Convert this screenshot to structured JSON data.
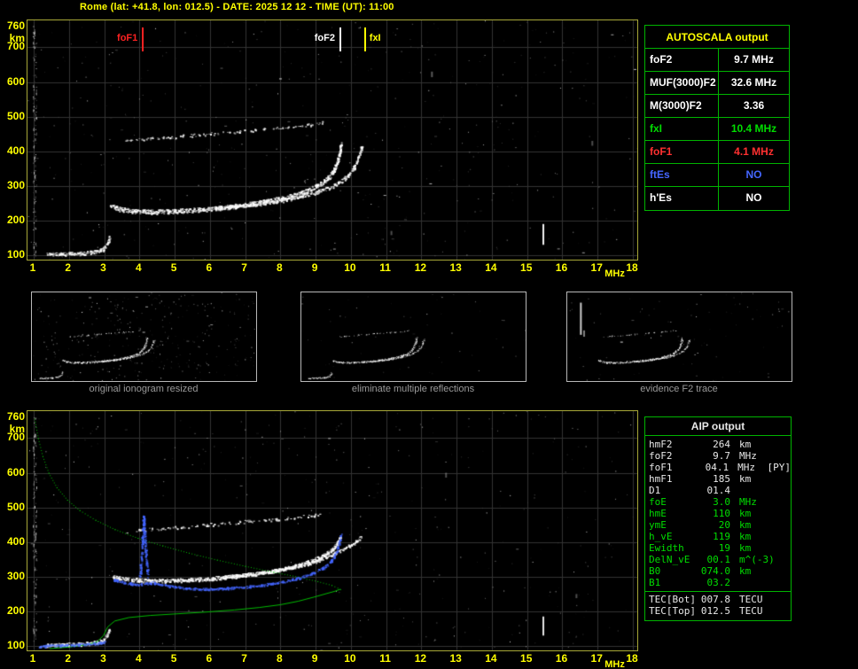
{
  "header": {
    "title": "Rome (lat: +41.8, lon: 012.5) - DATE: 2025 12 12 - TIME (UT): 11:00"
  },
  "colors": {
    "background": "#000000",
    "axis_text": "#ffff00",
    "plot_border": "#a8a838",
    "grid": "#333333",
    "table_border": "#00b400",
    "white": "#e8e8e8",
    "green": "#00dd00",
    "red": "#ff3030",
    "blue": "#4466ff",
    "caption": "#999999"
  },
  "axes": {
    "x_unit": "MHz",
    "y_unit": "km",
    "x_ticks": [
      1,
      2,
      3,
      4,
      5,
      6,
      7,
      8,
      9,
      10,
      11,
      12,
      13,
      14,
      15,
      16,
      17,
      18
    ],
    "y_ticks": [
      760,
      700,
      600,
      500,
      400,
      300,
      200,
      100
    ]
  },
  "autoscala": {
    "title": "AUTOSCALA output",
    "rows": [
      {
        "label": "foF2",
        "value": "9.7 MHz",
        "color": "#ffffff"
      },
      {
        "label": "MUF(3000)F2",
        "value": "32.6 MHz",
        "color": "#ffffff"
      },
      {
        "label": "M(3000)F2",
        "value": "3.36",
        "color": "#ffffff"
      },
      {
        "label": "fxI",
        "value": "10.4 MHz",
        "color": "#00dd00"
      },
      {
        "label": "foF1",
        "value": "4.1 MHz",
        "color": "#ff3030"
      },
      {
        "label": "ftEs",
        "value": "NO",
        "color": "#4466ff"
      },
      {
        "label": "h'Es",
        "value": "NO",
        "color": "#ffffff"
      }
    ]
  },
  "thumbnails": [
    {
      "caption": "original ionogram resized"
    },
    {
      "caption": "eliminate multiple reflections"
    },
    {
      "caption": "evidence F2 trace"
    }
  ],
  "aip": {
    "title": "AIP output",
    "rows": [
      {
        "label": "hmF2",
        "value": "264",
        "unit": "km",
        "extra": "",
        "color": "#e8e8e8"
      },
      {
        "label": "foF2",
        "value": "9.7",
        "unit": "MHz",
        "extra": "",
        "color": "#e8e8e8"
      },
      {
        "label": "foF1",
        "value": "04.1",
        "unit": "MHz",
        "extra": "[PY]",
        "color": "#e8e8e8"
      },
      {
        "label": "hmF1",
        "value": "185",
        "unit": "km",
        "extra": "",
        "color": "#e8e8e8"
      },
      {
        "label": "D1",
        "value": "01.4",
        "unit": "",
        "extra": "",
        "color": "#e8e8e8"
      },
      {
        "label": "foE",
        "value": "3.0",
        "unit": "MHz",
        "extra": "",
        "color": "#00dd00"
      },
      {
        "label": "hmE",
        "value": "110",
        "unit": "km",
        "extra": "",
        "color": "#00dd00"
      },
      {
        "label": "ymE",
        "value": "20",
        "unit": "km",
        "extra": "",
        "color": "#00dd00"
      },
      {
        "label": "h_vE",
        "value": "119",
        "unit": "km",
        "extra": "",
        "color": "#00dd00"
      },
      {
        "label": "Ewidth",
        "value": "19",
        "unit": "km",
        "extra": "",
        "color": "#00dd00"
      },
      {
        "label": "DelN_vE",
        "value": "00.1",
        "unit": "m^(-3)",
        "extra": "",
        "color": "#00dd00"
      },
      {
        "label": "B0",
        "value": "074.0",
        "unit": "km",
        "extra": "",
        "color": "#00dd00"
      },
      {
        "label": "B1",
        "value": "03.2",
        "unit": "",
        "extra": "",
        "color": "#00dd00"
      }
    ],
    "tec_rows": [
      {
        "label": "TEC[Bot]",
        "value": "007.8",
        "unit": "TECU",
        "color": "#e8e8e8"
      },
      {
        "label": "TEC[Top]",
        "value": "012.5",
        "unit": "TECU",
        "color": "#e8e8e8"
      }
    ]
  },
  "chart_data": [
    {
      "id": "top_ionogram",
      "type": "scatter",
      "title": "recorded ionogram (virtual height vs frequency)",
      "xlabel": "MHz",
      "ylabel": "km",
      "xlim": [
        1,
        18
      ],
      "ylim": [
        100,
        760
      ],
      "grid": true,
      "seed": 7,
      "noise": 500,
      "edge_column": 130,
      "markers": [
        {
          "label": "foF1",
          "x": 4.1,
          "color": "#ff2222",
          "side": "left"
        },
        {
          "label": "foF2",
          "x": 9.7,
          "color": "#ffffff",
          "side": "left"
        },
        {
          "label": "fxI",
          "x": 10.4,
          "color": "#ffff00",
          "side": "right"
        }
      ],
      "dashes": [
        [
          15.46,
          190,
          60,
          0.95
        ],
        [
          12.3,
          630,
          16,
          0.35
        ],
        [
          11.15,
          170,
          12,
          0.3
        ],
        [
          16.85,
          430,
          14,
          0.3
        ]
      ],
      "traces": [
        {
          "id": "E",
          "style": "scatter",
          "color": "#ffffff",
          "jitter": 5,
          "density": 2.2,
          "size": 2,
          "points": [
            [
              1.35,
              103
            ],
            [
              1.8,
              104
            ],
            [
              2.3,
              106
            ],
            [
              2.7,
              110
            ],
            [
              2.95,
              117
            ],
            [
              3.07,
              132
            ],
            [
              3.14,
              152
            ]
          ]
        },
        {
          "id": "F_O",
          "style": "scatter",
          "color": "#ffffff",
          "jitter": 6,
          "density": 2.6,
          "size": 2,
          "points": [
            [
              3.15,
              246
            ],
            [
              3.45,
              234
            ],
            [
              3.85,
              228
            ],
            [
              4.35,
              226
            ],
            [
              5.0,
              228
            ],
            [
              5.65,
              232
            ],
            [
              6.3,
              238
            ],
            [
              6.95,
              246
            ],
            [
              7.6,
              256
            ],
            [
              8.2,
              269
            ],
            [
              8.7,
              285
            ],
            [
              9.1,
              303
            ],
            [
              9.35,
              324
            ],
            [
              9.52,
              348
            ],
            [
              9.62,
              375
            ],
            [
              9.68,
              402
            ],
            [
              9.71,
              428
            ]
          ]
        },
        {
          "id": "F_X",
          "style": "scatter",
          "color": "#ffffff",
          "jitter": 5,
          "density": 1.8,
          "size": 2,
          "points": [
            [
              6.1,
              236
            ],
            [
              6.9,
              243
            ],
            [
              7.6,
              252
            ],
            [
              8.3,
              264
            ],
            [
              8.9,
              279
            ],
            [
              9.4,
              297
            ],
            [
              9.8,
              320
            ],
            [
              10.05,
              348
            ],
            [
              10.2,
              380
            ],
            [
              10.3,
              415
            ]
          ]
        },
        {
          "id": "second",
          "style": "scatter",
          "color": "#ffffff",
          "jitter": 4,
          "density": 0.5,
          "size": 2,
          "points": [
            [
              3.55,
              430
            ],
            [
              4.15,
              436
            ],
            [
              4.75,
              441
            ],
            [
              5.35,
              446
            ],
            [
              5.95,
              451
            ],
            [
              6.55,
              456
            ],
            [
              7.15,
              461
            ],
            [
              7.75,
              466
            ],
            [
              8.35,
              471
            ],
            [
              8.85,
              477
            ],
            [
              9.2,
              484
            ]
          ]
        }
      ]
    },
    {
      "id": "bottom_ionogram",
      "type": "scatter",
      "title": "restored traces and electron density profile",
      "xlabel": "MHz",
      "ylabel": "km",
      "xlim": [
        1,
        18
      ],
      "ylim": [
        100,
        760
      ],
      "grid": true,
      "seed": 13,
      "noise": 430,
      "edge_column": 120,
      "dashes": [
        [
          15.46,
          185,
          55,
          0.9
        ],
        [
          12.7,
          600,
          14,
          0.3
        ],
        [
          16.4,
          250,
          12,
          0.3
        ]
      ],
      "traces": [
        {
          "id": "E",
          "style": "scatter",
          "color": "#ffffff",
          "jitter": 5,
          "density": 2.0,
          "size": 2,
          "points": [
            [
              1.35,
              103
            ],
            [
              1.8,
              104
            ],
            [
              2.3,
              106
            ],
            [
              2.7,
              110
            ],
            [
              2.95,
              117
            ],
            [
              3.07,
              132
            ],
            [
              3.14,
              152
            ]
          ]
        },
        {
          "id": "F_O",
          "style": "scatter",
          "color": "#ffffff",
          "jitter": 5,
          "density": 2.6,
          "size": 2,
          "points": [
            [
              3.2,
              302
            ],
            [
              3.6,
              294
            ],
            [
              4.1,
              290
            ],
            [
              4.7,
              289
            ],
            [
              5.3,
              291
            ],
            [
              5.95,
              295
            ],
            [
              6.6,
              301
            ],
            [
              7.25,
              309
            ],
            [
              7.85,
              319
            ],
            [
              8.4,
              331
            ],
            [
              8.85,
              345
            ],
            [
              9.2,
              361
            ],
            [
              9.45,
              379
            ],
            [
              9.6,
              397
            ],
            [
              9.69,
              414
            ]
          ]
        },
        {
          "id": "F_X",
          "style": "scatter",
          "color": "#ffffff",
          "jitter": 4,
          "density": 1.8,
          "size": 2,
          "points": [
            [
              6.3,
              299
            ],
            [
              7.1,
              307
            ],
            [
              7.8,
              317
            ],
            [
              8.5,
              331
            ],
            [
              9.0,
              346
            ],
            [
              9.45,
              364
            ],
            [
              9.85,
              384
            ],
            [
              10.12,
              401
            ],
            [
              10.3,
              417
            ]
          ]
        },
        {
          "id": "second",
          "style": "scatter",
          "color": "#ffffff",
          "jitter": 4,
          "density": 0.5,
          "size": 2,
          "points": [
            [
              3.55,
              430
            ],
            [
              4.15,
              436
            ],
            [
              4.75,
              441
            ],
            [
              5.35,
              446
            ],
            [
              5.95,
              451
            ],
            [
              6.55,
              456
            ],
            [
              7.15,
              461
            ],
            [
              7.75,
              466
            ],
            [
              8.35,
              471
            ],
            [
              8.85,
              477
            ],
            [
              9.2,
              484
            ]
          ]
        },
        {
          "id": "green_topside",
          "style": "dots",
          "color": "#00bb00",
          "width": 1,
          "points": [
            [
              1.02,
              756
            ],
            [
              1.12,
              700
            ],
            [
              1.25,
              648
            ],
            [
              1.42,
              600
            ],
            [
              1.65,
              558
            ],
            [
              1.95,
              522
            ],
            [
              2.3,
              492
            ],
            [
              2.75,
              464
            ],
            [
              3.3,
              437
            ],
            [
              3.95,
              412
            ],
            [
              4.65,
              390
            ],
            [
              5.4,
              369
            ],
            [
              6.2,
              349
            ],
            [
              7.0,
              331
            ],
            [
              7.8,
              314
            ],
            [
              8.5,
              300
            ],
            [
              9.05,
              287
            ],
            [
              9.45,
              276
            ],
            [
              9.7,
              264
            ]
          ]
        },
        {
          "id": "green_bottomside",
          "style": "line",
          "color": "#00bb00",
          "width": 1,
          "points": [
            [
              1.45,
              92
            ],
            [
              2.0,
              97
            ],
            [
              2.5,
              103
            ],
            [
              2.8,
              112
            ],
            [
              2.98,
              130
            ],
            [
              3.1,
              155
            ],
            [
              3.3,
              172
            ],
            [
              3.7,
              182
            ],
            [
              4.3,
              188
            ],
            [
              5.1,
              193
            ],
            [
              5.9,
              198
            ],
            [
              6.7,
              204
            ],
            [
              7.4,
              211
            ],
            [
              8.0,
              219
            ],
            [
              8.5,
              229
            ],
            [
              8.95,
              241
            ],
            [
              9.3,
              251
            ],
            [
              9.55,
              258
            ],
            [
              9.7,
              264
            ]
          ]
        },
        {
          "id": "blue_E",
          "style": "scatter",
          "color": "#5577ff",
          "jitter": 3,
          "density": 2.0,
          "size": 2,
          "points": [
            [
              1.15,
              100
            ],
            [
              1.6,
              102
            ],
            [
              2.1,
              104
            ],
            [
              2.6,
              107
            ],
            [
              3.0,
              112
            ]
          ]
        },
        {
          "id": "blue_F",
          "style": "scatter",
          "color": "#4466ff",
          "jitter": 3,
          "density": 1.7,
          "size": 2,
          "points": [
            [
              3.25,
              293
            ],
            [
              3.6,
              283
            ],
            [
              3.95,
              278
            ],
            [
              4.35,
              284
            ],
            [
              4.8,
              274
            ],
            [
              5.3,
              268
            ],
            [
              5.85,
              265
            ],
            [
              6.4,
              267
            ],
            [
              6.95,
              271
            ],
            [
              7.5,
              277
            ],
            [
              8.05,
              286
            ],
            [
              8.55,
              298
            ],
            [
              8.95,
              312
            ],
            [
              9.25,
              329
            ],
            [
              9.45,
              349
            ],
            [
              9.58,
              372
            ],
            [
              9.66,
              399
            ],
            [
              9.7,
              424
            ]
          ]
        },
        {
          "id": "blue_spike",
          "style": "scatter",
          "color": "#4466ff",
          "jitter": 2.5,
          "density": 1.6,
          "size": 2,
          "points": [
            [
              4.0,
              300
            ],
            [
              4.05,
              355
            ],
            [
              4.08,
              420
            ],
            [
              4.11,
              478
            ],
            [
              4.14,
              420
            ],
            [
              4.18,
              355
            ],
            [
              4.23,
              300
            ]
          ]
        }
      ]
    },
    {
      "id": "thumb_original",
      "type": "scatter",
      "grid": false,
      "seed": 21,
      "noise": 340,
      "include": [
        "E",
        "F_O",
        "F_X",
        "second"
      ],
      "xlim": [
        1,
        18
      ],
      "ylim": [
        100,
        760
      ]
    },
    {
      "id": "thumb_no_multiples",
      "type": "scatter",
      "grid": false,
      "seed": 22,
      "noise": 60,
      "include": [
        "E",
        "F_O",
        "F_X",
        "second"
      ],
      "xlim": [
        1,
        18
      ],
      "ylim": [
        100,
        760
      ]
    },
    {
      "id": "thumb_f2_trace",
      "type": "scatter",
      "grid": false,
      "seed": 23,
      "noise": 85,
      "include": [
        "F_O",
        "F_X",
        "second"
      ],
      "dashes": [
        [
          1.85,
          700,
          255,
          0.8
        ],
        [
          2.1,
          480,
          50,
          0.5
        ]
      ],
      "xlim": [
        1,
        18
      ],
      "ylim": [
        100,
        760
      ]
    }
  ]
}
